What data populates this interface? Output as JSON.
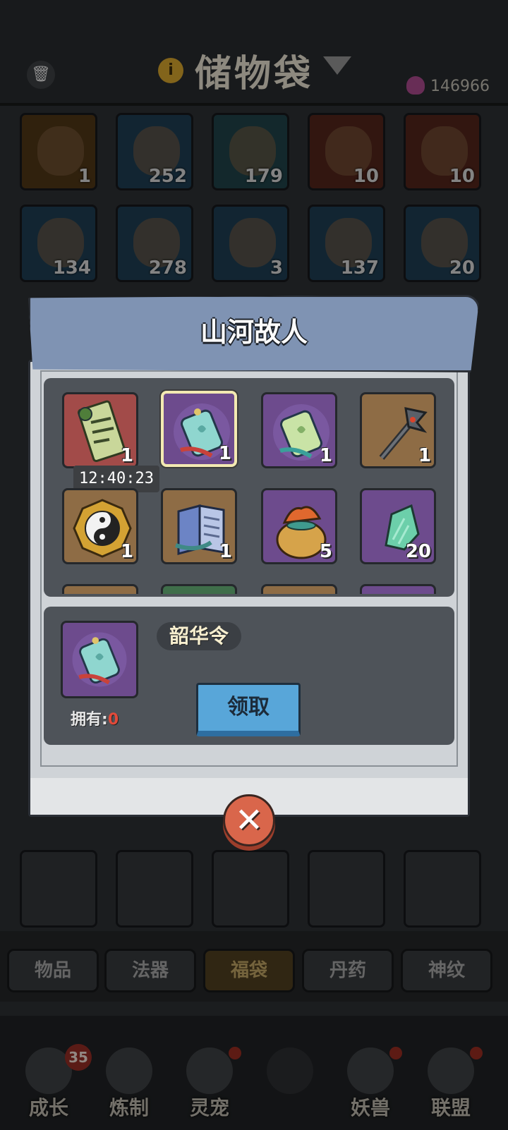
{
  "background": {
    "title": "储物袋",
    "currency_count": "146966",
    "slots_row1": [
      "1",
      "252",
      "179",
      "10",
      "10"
    ],
    "slots_row2": [
      "134",
      "278",
      "3",
      "137",
      "20"
    ],
    "tabs": [
      "物品",
      "法器",
      "福袋",
      "丹药",
      "神纹"
    ],
    "selected_tab": "福袋",
    "nav": [
      {
        "label": "成长",
        "badge": "35"
      },
      {
        "label": "炼制"
      },
      {
        "label": "灵宠"
      },
      {
        "label": ""
      },
      {
        "label": "妖兽"
      },
      {
        "label": "联盟"
      }
    ]
  },
  "modal": {
    "title": "山河故人",
    "items": [
      {
        "name": "兔 scroll",
        "count": "1",
        "rarity": "red"
      },
      {
        "name": "jade token",
        "count": "1",
        "rarity": "purple",
        "selected": true
      },
      {
        "name": "jade token yellow",
        "count": "1",
        "rarity": "purple"
      },
      {
        "name": "dragon staff",
        "count": "1",
        "rarity": "gold"
      },
      {
        "name": "yin yang bagua",
        "count": "1",
        "rarity": "gold"
      },
      {
        "name": "book",
        "count": "1",
        "rarity": "gold"
      },
      {
        "name": "lucky bag",
        "count": "5",
        "rarity": "purple"
      },
      {
        "name": "jade stone",
        "count": "20",
        "rarity": "purple"
      }
    ],
    "timer": "12:40:23",
    "detail": {
      "item_name": "韶华令",
      "own_label": "拥有:",
      "own_count": "0",
      "claim_label": "领取"
    },
    "close_icon": "close-icon"
  },
  "colors": {
    "rarity_red": "#a24b49",
    "rarity_purple": "#6d4b8d",
    "rarity_gold": "#8e6c45",
    "claim_button": "#58a6d9",
    "close_button": "#d9664b"
  }
}
